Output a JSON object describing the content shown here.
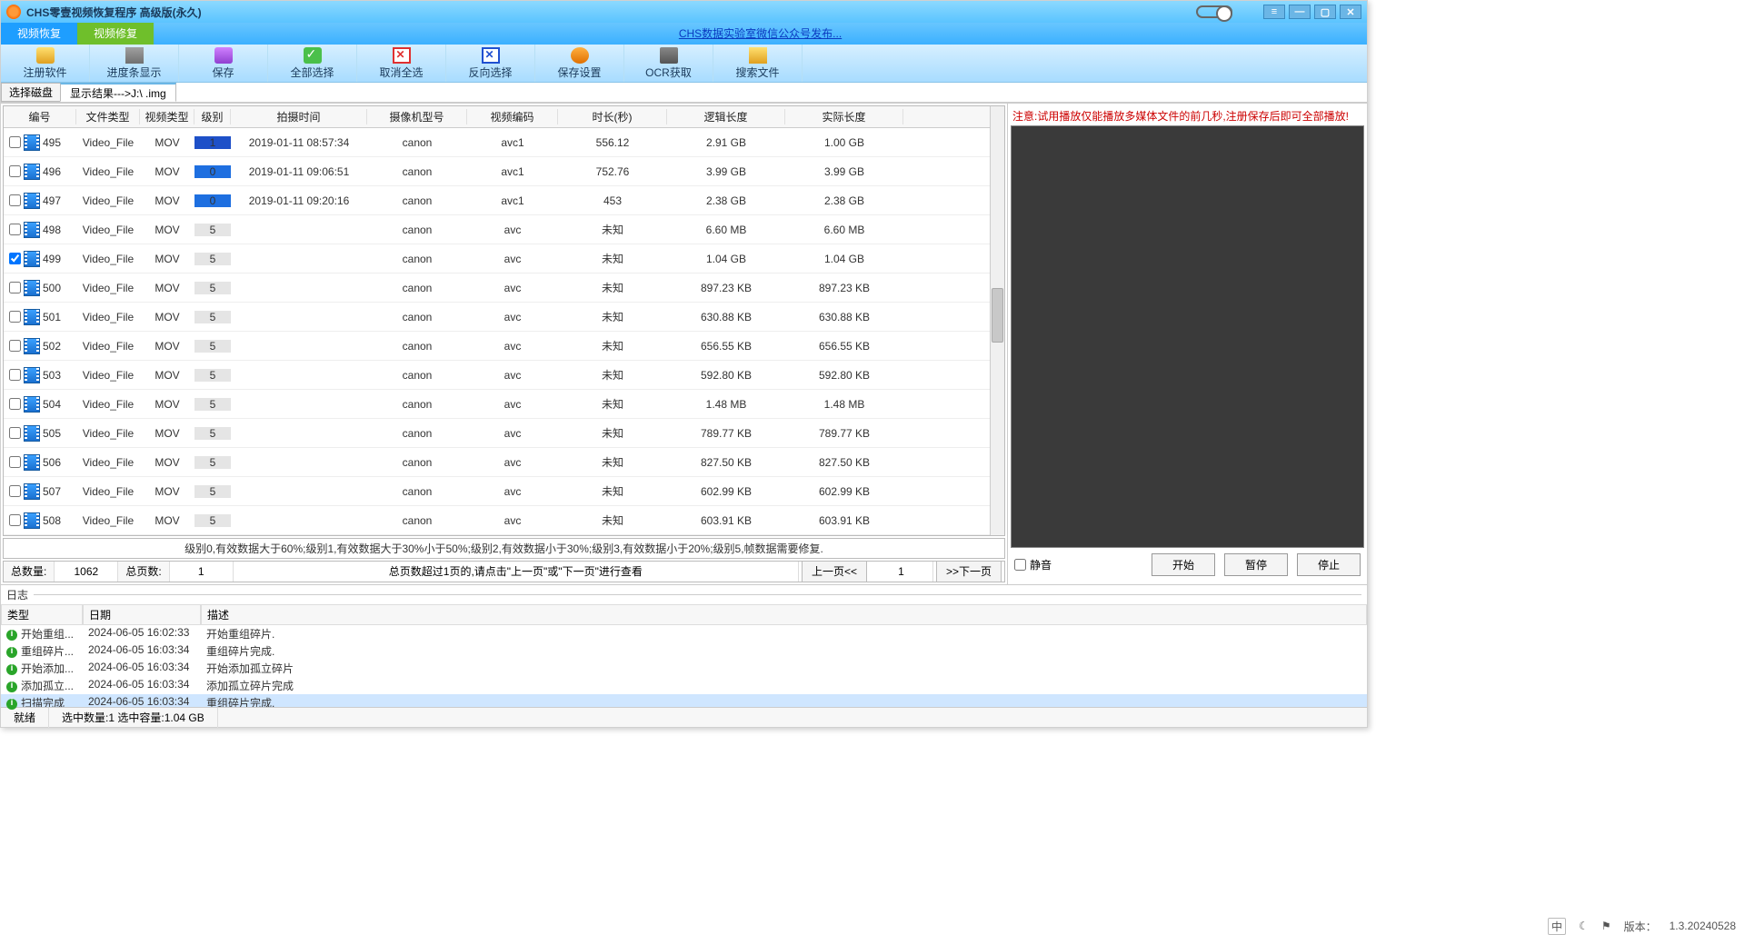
{
  "titlebar": {
    "title": "CHS零壹视频恢复程序 高级版(永久)"
  },
  "tabs": {
    "recover": "视频恢复",
    "repair": "视频修复",
    "link": "CHS数据实验室微信公众号发布..."
  },
  "toolbar": [
    {
      "name": "register",
      "label": "注册软件",
      "icon": "ic-key"
    },
    {
      "name": "progress",
      "label": "进度条显示",
      "icon": "ic-prog"
    },
    {
      "name": "save",
      "label": "保存",
      "icon": "ic-save"
    },
    {
      "name": "select-all",
      "label": "全部选择",
      "icon": "ic-all"
    },
    {
      "name": "deselect",
      "label": "取消全选",
      "icon": "ic-x"
    },
    {
      "name": "invert",
      "label": "反向选择",
      "icon": "ic-xb"
    },
    {
      "name": "save-settings",
      "label": "保存设置",
      "icon": "ic-set"
    },
    {
      "name": "ocr",
      "label": "OCR获取",
      "icon": "ic-ocr"
    },
    {
      "name": "search",
      "label": "搜索文件",
      "icon": "ic-sea"
    }
  ],
  "subbar": {
    "selectDisk": "选择磁盘",
    "resultTab": "显示结果--->J:\\                                  .img"
  },
  "columns": [
    "编号",
    "文件类型",
    "视频类型",
    "级别",
    "拍摄时间",
    "摄像机型号",
    "视频编码",
    "时长(秒)",
    "逻辑长度",
    "实际长度"
  ],
  "rows": [
    {
      "chk": false,
      "id": "495",
      "ftype": "Video_File",
      "vtype": "MOV",
      "lvl": "1",
      "lvlcls": "lvl1",
      "time": "2019-01-11 08:57:34",
      "cam": "canon",
      "codec": "avc1",
      "dur": "556.12",
      "logic": "2.91 GB",
      "real": "1.00 GB"
    },
    {
      "chk": false,
      "id": "496",
      "ftype": "Video_File",
      "vtype": "MOV",
      "lvl": "0",
      "lvlcls": "lvl0",
      "time": "2019-01-11 09:06:51",
      "cam": "canon",
      "codec": "avc1",
      "dur": "752.76",
      "logic": "3.99 GB",
      "real": "3.99 GB"
    },
    {
      "chk": false,
      "id": "497",
      "ftype": "Video_File",
      "vtype": "MOV",
      "lvl": "0",
      "lvlcls": "lvl0",
      "time": "2019-01-11 09:20:16",
      "cam": "canon",
      "codec": "avc1",
      "dur": "453",
      "logic": "2.38 GB",
      "real": "2.38 GB"
    },
    {
      "chk": false,
      "id": "498",
      "ftype": "Video_File",
      "vtype": "MOV",
      "lvl": "5",
      "lvlcls": "lvl5",
      "time": "",
      "cam": "canon",
      "codec": "avc",
      "dur": "未知",
      "logic": "6.60 MB",
      "real": "6.60 MB"
    },
    {
      "chk": true,
      "id": "499",
      "ftype": "Video_File",
      "vtype": "MOV",
      "lvl": "5",
      "lvlcls": "lvl5",
      "time": "",
      "cam": "canon",
      "codec": "avc",
      "dur": "未知",
      "logic": "1.04 GB",
      "real": "1.04 GB"
    },
    {
      "chk": false,
      "id": "500",
      "ftype": "Video_File",
      "vtype": "MOV",
      "lvl": "5",
      "lvlcls": "lvl5",
      "time": "",
      "cam": "canon",
      "codec": "avc",
      "dur": "未知",
      "logic": "897.23 KB",
      "real": "897.23 KB"
    },
    {
      "chk": false,
      "id": "501",
      "ftype": "Video_File",
      "vtype": "MOV",
      "lvl": "5",
      "lvlcls": "lvl5",
      "time": "",
      "cam": "canon",
      "codec": "avc",
      "dur": "未知",
      "logic": "630.88 KB",
      "real": "630.88 KB"
    },
    {
      "chk": false,
      "id": "502",
      "ftype": "Video_File",
      "vtype": "MOV",
      "lvl": "5",
      "lvlcls": "lvl5",
      "time": "",
      "cam": "canon",
      "codec": "avc",
      "dur": "未知",
      "logic": "656.55 KB",
      "real": "656.55 KB"
    },
    {
      "chk": false,
      "id": "503",
      "ftype": "Video_File",
      "vtype": "MOV",
      "lvl": "5",
      "lvlcls": "lvl5",
      "time": "",
      "cam": "canon",
      "codec": "avc",
      "dur": "未知",
      "logic": "592.80 KB",
      "real": "592.80 KB"
    },
    {
      "chk": false,
      "id": "504",
      "ftype": "Video_File",
      "vtype": "MOV",
      "lvl": "5",
      "lvlcls": "lvl5",
      "time": "",
      "cam": "canon",
      "codec": "avc",
      "dur": "未知",
      "logic": "1.48 MB",
      "real": "1.48 MB"
    },
    {
      "chk": false,
      "id": "505",
      "ftype": "Video_File",
      "vtype": "MOV",
      "lvl": "5",
      "lvlcls": "lvl5",
      "time": "",
      "cam": "canon",
      "codec": "avc",
      "dur": "未知",
      "logic": "789.77 KB",
      "real": "789.77 KB"
    },
    {
      "chk": false,
      "id": "506",
      "ftype": "Video_File",
      "vtype": "MOV",
      "lvl": "5",
      "lvlcls": "lvl5",
      "time": "",
      "cam": "canon",
      "codec": "avc",
      "dur": "未知",
      "logic": "827.50 KB",
      "real": "827.50 KB"
    },
    {
      "chk": false,
      "id": "507",
      "ftype": "Video_File",
      "vtype": "MOV",
      "lvl": "5",
      "lvlcls": "lvl5",
      "time": "",
      "cam": "canon",
      "codec": "avc",
      "dur": "未知",
      "logic": "602.99 KB",
      "real": "602.99 KB"
    },
    {
      "chk": false,
      "id": "508",
      "ftype": "Video_File",
      "vtype": "MOV",
      "lvl": "5",
      "lvlcls": "lvl5",
      "time": "",
      "cam": "canon",
      "codec": "avc",
      "dur": "未知",
      "logic": "603.91 KB",
      "real": "603.91 KB"
    }
  ],
  "hint": "级别0,有效数据大于60%;级别1,有效数据大于30%小于50%;级别2,有效数据小于30%;级别3,有效数据小于20%;级别5,帧数据需要修复.",
  "pager": {
    "totalLabel": "总数量:",
    "total": "1062",
    "pagesLabel": "总页数:",
    "pages": "1",
    "mid": "总页数超过1页的,请点击\"上一页\"或\"下一页\"进行查看",
    "prev": "上一页<<",
    "cur": "1",
    "next": ">>下一页"
  },
  "right": {
    "notice": "注意:试用播放仅能播放多媒体文件的前几秒,注册保存后即可全部播放!",
    "mute": "静音",
    "start": "开始",
    "pause": "暂停",
    "stop": "停止"
  },
  "log": {
    "title": "日志",
    "cols": [
      "类型",
      "日期",
      "描述"
    ],
    "rows": [
      {
        "sel": false,
        "type": "开始重组...",
        "date": "2024-06-05 16:02:33",
        "desc": "开始重组碎片."
      },
      {
        "sel": false,
        "type": "重组碎片...",
        "date": "2024-06-05 16:03:34",
        "desc": "重组碎片完成."
      },
      {
        "sel": false,
        "type": "开始添加...",
        "date": "2024-06-05 16:03:34",
        "desc": "开始添加孤立碎片"
      },
      {
        "sel": false,
        "type": "添加孤立...",
        "date": "2024-06-05 16:03:34",
        "desc": "添加孤立碎片完成"
      },
      {
        "sel": true,
        "type": "扫描完成",
        "date": "2024-06-05 16:03:34",
        "desc": "重组碎片完成."
      }
    ]
  },
  "status": {
    "ready": "就绪",
    "sel": "选中数量:1 选中容量:1.04 GB"
  },
  "taskbar": {
    "ime": "中",
    "version_label": "版本：",
    "version": "1.3.20240528"
  }
}
